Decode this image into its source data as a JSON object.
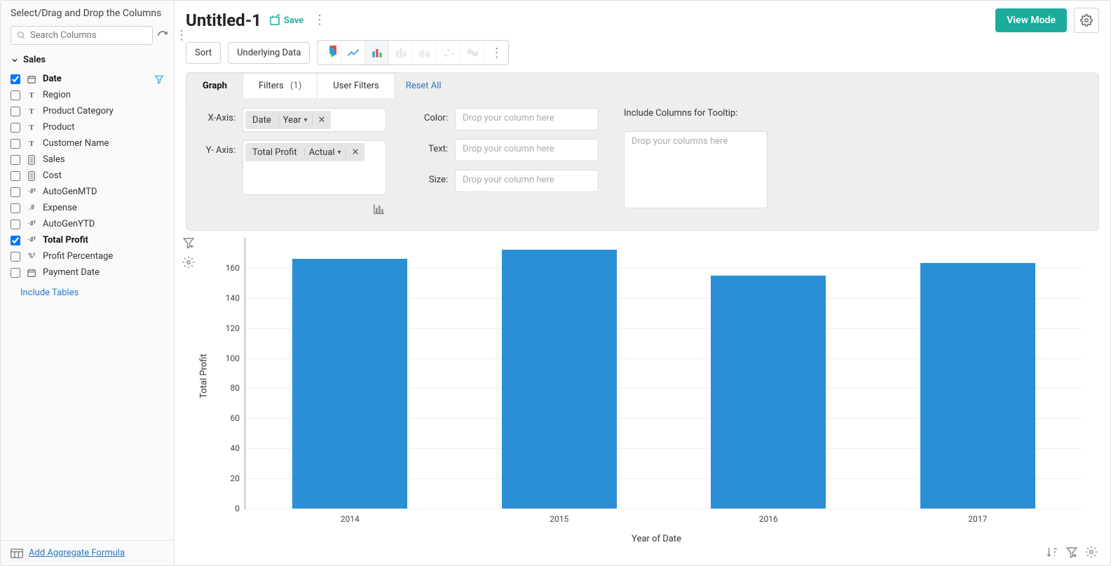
{
  "sidebar": {
    "header": "Select/Drag and Drop the Columns",
    "search_placeholder": "Search Columns",
    "group": "Sales",
    "columns": [
      {
        "label": "Date",
        "type": "date",
        "checked": true,
        "filter": true
      },
      {
        "label": "Region",
        "type": "T",
        "checked": false
      },
      {
        "label": "Product Category",
        "type": "T",
        "checked": false
      },
      {
        "label": "Product",
        "type": "T",
        "checked": false
      },
      {
        "label": "Customer Name",
        "type": "T",
        "checked": false
      },
      {
        "label": "Sales",
        "type": "num",
        "checked": false
      },
      {
        "label": "Cost",
        "type": "num",
        "checked": false
      },
      {
        "label": "AutoGenMTD",
        "type": "fx",
        "checked": false
      },
      {
        "label": "Expense",
        "type": "dec",
        "checked": false
      },
      {
        "label": "AutoGenYTD",
        "type": "fx",
        "checked": false
      },
      {
        "label": "Total Profit",
        "type": "fx",
        "checked": true
      },
      {
        "label": "Profit Percentage",
        "type": "pct",
        "checked": false
      },
      {
        "label": "Payment Date",
        "type": "date",
        "checked": false
      }
    ],
    "include_tables": "Include Tables",
    "add_formula": "Add Aggregate Formula"
  },
  "header": {
    "title": "Untitled-1",
    "save": "Save",
    "view_mode": "View Mode"
  },
  "toolbar": {
    "sort": "Sort",
    "underlying": "Underlying Data"
  },
  "tabs": {
    "graph": "Graph",
    "filters": "Filters",
    "filters_count": "(1)",
    "user_filters": "User Filters",
    "reset": "Reset All"
  },
  "config": {
    "xaxis_label": "X-Axis:",
    "yaxis_label": "Y- Axis:",
    "color_label": "Color:",
    "text_label": "Text:",
    "size_label": "Size:",
    "tooltip_label": "Include Columns for Tooltip:",
    "drop_col": "Drop your column here",
    "drop_cols": "Drop your columns here",
    "x_chip": {
      "name": "Date",
      "mode": "Year"
    },
    "y_chip": {
      "name": "Total Profit",
      "mode": "Actual"
    }
  },
  "chart_data": {
    "type": "bar",
    "categories": [
      "2014",
      "2015",
      "2016",
      "2017"
    ],
    "values": [
      166,
      172,
      155,
      163
    ],
    "ylabel": "Total Profit",
    "xlabel": "Year of Date",
    "ylim": [
      0,
      180
    ],
    "yticks": [
      0,
      20,
      40,
      60,
      80,
      100,
      120,
      140,
      160
    ]
  },
  "colors": {
    "accent": "#1aab9b",
    "bar": "#2a8fd4",
    "link": "#2a78c4"
  }
}
